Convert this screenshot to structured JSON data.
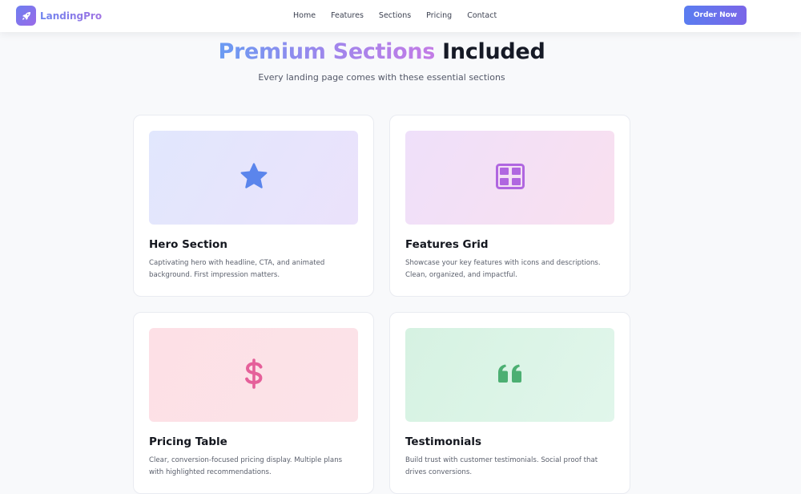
{
  "nav": {
    "brand": "LandingPro",
    "brand_icon": "rocket-icon",
    "links": [
      "Home",
      "Features",
      "Sections",
      "Pricing",
      "Contact"
    ],
    "cta": "Order Now"
  },
  "hero": {
    "title_highlight": "Premium Sections",
    "title_rest": "Included",
    "subtitle": "Every landing page comes with these essential sections"
  },
  "colors": {
    "accent": "#5b7cf0",
    "star": "#5b85ec",
    "grid": "#b066e0",
    "dollar": "#e5609a",
    "quote": "#4caf72"
  },
  "cards": [
    {
      "icon": "star-icon",
      "title": "Hero Section",
      "description": "Captivating hero with headline, CTA, and animated background. First impression matters."
    },
    {
      "icon": "grid-icon",
      "title": "Features Grid",
      "description": "Showcase your key features with icons and descriptions. Clean, organized, and impactful."
    },
    {
      "icon": "dollar-icon",
      "title": "Pricing Table",
      "description": "Clear, conversion-focused pricing display. Multiple plans with highlighted recommendations."
    },
    {
      "icon": "quote-icon",
      "title": "Testimonials",
      "description": "Build trust with customer testimonials. Social proof that drives conversions."
    }
  ]
}
